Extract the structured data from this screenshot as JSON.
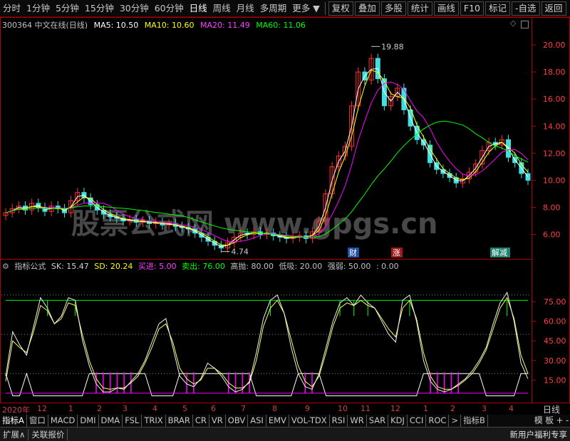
{
  "periods": [
    "分时",
    "1分钟",
    "5分钟",
    "15分钟",
    "30分钟",
    "60分钟",
    "日线",
    "周线",
    "月线",
    "多周期",
    "更多"
  ],
  "active_period": "日线",
  "toolbar": [
    "复权",
    "叠加",
    "多股",
    "统计",
    "画线",
    "F10",
    "标记",
    "自选",
    "返回"
  ],
  "stock": {
    "title": "300364 中文在线(日线)",
    "ma5": "MA5: 10.50",
    "ma10": "MA10: 10.60",
    "ma20": "MA20: 11.49",
    "ma60": "MA60: 11.06",
    "high_label": "19.88",
    "low_label": "4.74"
  },
  "watermark": "股票公式网 www.gpgs.cn",
  "markers": [
    "财",
    "涨",
    "解减"
  ],
  "indicator": {
    "name": "指标公式",
    "sk": "SK: 15.47",
    "sd": "SD: 20.24",
    "buy": "买进: 5.00",
    "sell": "卖出: 76.00",
    "high": "高抛: 80.00",
    "low": "低吸: 20.00",
    "strength": "强弱: 50.00",
    "extra": ": 0.00"
  },
  "x_axis": {
    "year": "2020年",
    "months": [
      "12",
      "1",
      "2",
      "3",
      "4",
      "5",
      "6",
      "7",
      "8",
      "9",
      "10",
      "11",
      "12",
      "1",
      "2",
      "3",
      "4"
    ]
  },
  "period_label": "日线",
  "tabs": [
    "指标A",
    "窗口",
    "MACD",
    "DMI",
    "DMA",
    "FSL",
    "TRIX",
    "BRAR",
    "CR",
    "VR",
    "OBV",
    "ASI",
    "EMV",
    "VOL-TDX",
    "RSI",
    "WR",
    "SAR",
    "KDJ",
    "CCI",
    "ROC",
    ">",
    "指标B"
  ],
  "zoom": [
    "模",
    "板",
    "+",
    "-"
  ],
  "status": [
    "扩展∧",
    "关联报价"
  ],
  "promo": "新用户福利专享",
  "colors": {
    "ma5": "#ffffff",
    "ma10": "#ffff00",
    "ma20": "#ff00ff",
    "ma60": "#00ff00",
    "up": "#ff3030",
    "down": "#40e0e0",
    "border": "#b00000"
  },
  "chart_data": {
    "type": "candlestick",
    "price_axis": {
      "ticks": [
        20.0,
        18.0,
        16.0,
        14.0,
        12.0,
        10.0,
        8.0,
        6.0
      ],
      "range": [
        4.3,
        21.0
      ]
    },
    "ma_values": {
      "ma5": 10.5,
      "ma10": 10.6,
      "ma20": 11.49,
      "ma60": 11.06
    },
    "high": 19.88,
    "low": 4.74,
    "close_path": [
      7.6,
      7.9,
      8.1,
      7.8,
      8.3,
      8.0,
      7.7,
      8.1,
      7.9,
      7.6,
      8.5,
      9.1,
      8.7,
      8.2,
      7.8,
      7.5,
      7.3,
      7.2,
      7.0,
      7.1,
      6.9,
      7.0,
      6.8,
      6.9,
      6.7,
      6.8,
      6.6,
      6.5,
      6.4,
      6.1,
      5.8,
      5.5,
      5.2,
      5.0,
      5.4,
      5.8,
      6.1,
      6.0,
      6.2,
      6.0,
      6.1,
      5.9,
      5.8,
      5.7,
      5.8,
      5.9,
      5.7,
      6.2,
      7.0,
      9.0,
      11.0,
      11.8,
      12.5,
      15.5,
      18.0,
      17.4,
      19.0,
      17.5,
      15.5,
      16.2,
      16.8,
      15.2,
      14.0,
      13.0,
      12.6,
      11.3,
      10.8,
      10.5,
      10.2,
      9.8,
      10.1,
      10.6,
      11.2,
      12.2,
      12.8,
      12.6,
      13.0,
      11.7,
      11.3,
      10.5,
      10.0
    ],
    "indicator_axis": {
      "ticks": [
        75.0,
        60.0,
        45.0,
        30.0,
        15.0
      ],
      "range": [
        0,
        100
      ],
      "dotted": [
        80,
        50,
        20
      ]
    },
    "sk_path": [
      18,
      52,
      42,
      34,
      56,
      78,
      70,
      58,
      64,
      78,
      76,
      46,
      26,
      12,
      6,
      6,
      9,
      8,
      14,
      20,
      30,
      44,
      58,
      62,
      40,
      18,
      12,
      10,
      16,
      28,
      24,
      18,
      10,
      6,
      8,
      14,
      36,
      62,
      76,
      80,
      66,
      40,
      20,
      10,
      8,
      20,
      40,
      60,
      74,
      78,
      72,
      80,
      74,
      70,
      60,
      50,
      44,
      76,
      80,
      60,
      30,
      14,
      8,
      6,
      8,
      12,
      16,
      22,
      30,
      40,
      58,
      74,
      82,
      60,
      28,
      16
    ],
    "sd_path": [
      14,
      45,
      40,
      36,
      52,
      72,
      68,
      58,
      62,
      74,
      72,
      50,
      30,
      16,
      9,
      8,
      9,
      9,
      13,
      18,
      28,
      40,
      54,
      58,
      44,
      24,
      16,
      12,
      15,
      24,
      24,
      20,
      13,
      9,
      9,
      13,
      30,
      56,
      70,
      76,
      66,
      46,
      26,
      14,
      10,
      18,
      36,
      56,
      70,
      74,
      72,
      76,
      72,
      70,
      62,
      54,
      48,
      70,
      76,
      62,
      36,
      18,
      10,
      8,
      8,
      11,
      15,
      20,
      28,
      38,
      54,
      70,
      78,
      62,
      34,
      20
    ]
  }
}
